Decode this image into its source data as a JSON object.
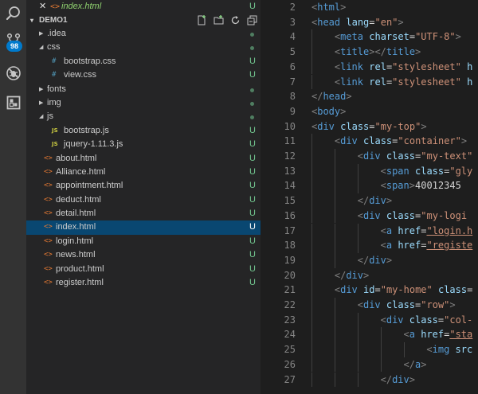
{
  "activity_bar": {
    "items": [
      {
        "name": "search-icon"
      },
      {
        "name": "source-control-icon",
        "badge": "98"
      },
      {
        "name": "debug-icon"
      },
      {
        "name": "extensions-icon"
      }
    ]
  },
  "open_editor": {
    "close": "✕",
    "icon": "<>",
    "file": "index.html",
    "status": "U"
  },
  "explorer": {
    "caret": "▾",
    "project": "DEMO1",
    "status": "U",
    "tools": [
      "new-file-icon",
      "new-folder-icon",
      "refresh-icon",
      "collapse-all-icon"
    ],
    "tree": [
      {
        "type": "folder",
        "label": ".idea",
        "open": false,
        "depth": 0,
        "status": "dot"
      },
      {
        "type": "folder",
        "label": "css",
        "open": true,
        "depth": 0,
        "status": "dot"
      },
      {
        "type": "css",
        "label": "bootstrap.css",
        "depth": 1,
        "status": "U"
      },
      {
        "type": "css",
        "label": "view.css",
        "depth": 1,
        "status": "U"
      },
      {
        "type": "folder",
        "label": "fonts",
        "open": false,
        "depth": 0,
        "status": "dot"
      },
      {
        "type": "folder",
        "label": "img",
        "open": false,
        "depth": 0,
        "status": "dot"
      },
      {
        "type": "folder",
        "label": "js",
        "open": true,
        "depth": 0,
        "status": "dot"
      },
      {
        "type": "js",
        "label": "bootstrap.js",
        "depth": 1,
        "status": "U"
      },
      {
        "type": "js",
        "label": "jquery-1.11.3.js",
        "depth": 1,
        "status": "U"
      },
      {
        "type": "html",
        "label": "about.html",
        "depth": 0,
        "status": "U"
      },
      {
        "type": "html",
        "label": "Alliance.html",
        "depth": 0,
        "status": "U"
      },
      {
        "type": "html",
        "label": "appointment.html",
        "depth": 0,
        "status": "U"
      },
      {
        "type": "html",
        "label": "deduct.html",
        "depth": 0,
        "status": "U"
      },
      {
        "type": "html",
        "label": "detail.html",
        "depth": 0,
        "status": "U"
      },
      {
        "type": "html",
        "label": "index.html",
        "depth": 0,
        "status": "U",
        "selected": true
      },
      {
        "type": "html",
        "label": "login.html",
        "depth": 0,
        "status": "U"
      },
      {
        "type": "html",
        "label": "news.html",
        "depth": 0,
        "status": "U"
      },
      {
        "type": "html",
        "label": "product.html",
        "depth": 0,
        "status": "U"
      },
      {
        "type": "html",
        "label": "register.html",
        "depth": 0,
        "status": "U"
      }
    ]
  },
  "editor": {
    "lines": [
      {
        "n": "2",
        "indent": 0,
        "tokens": [
          [
            "p",
            "<"
          ],
          [
            "t",
            "html"
          ],
          [
            "p",
            ">"
          ]
        ]
      },
      {
        "n": "3",
        "indent": 0,
        "tokens": [
          [
            "p",
            "<"
          ],
          [
            "t",
            "head"
          ],
          [
            "x",
            " "
          ],
          [
            "a",
            "lang"
          ],
          [
            "x",
            "="
          ],
          [
            "s",
            "\"en\""
          ],
          [
            "p",
            ">"
          ]
        ]
      },
      {
        "n": "4",
        "indent": 1,
        "tokens": [
          [
            "p",
            "<"
          ],
          [
            "t",
            "meta"
          ],
          [
            "x",
            " "
          ],
          [
            "a",
            "charset"
          ],
          [
            "x",
            "="
          ],
          [
            "s",
            "\"UTF-8\""
          ],
          [
            "p",
            ">"
          ]
        ]
      },
      {
        "n": "5",
        "indent": 1,
        "tokens": [
          [
            "p",
            "<"
          ],
          [
            "t",
            "title"
          ],
          [
            "p",
            "></"
          ],
          [
            "t",
            "title"
          ],
          [
            "p",
            ">"
          ]
        ]
      },
      {
        "n": "6",
        "indent": 1,
        "tokens": [
          [
            "p",
            "<"
          ],
          [
            "t",
            "link"
          ],
          [
            "x",
            " "
          ],
          [
            "a",
            "rel"
          ],
          [
            "x",
            "="
          ],
          [
            "s",
            "\"stylesheet\""
          ],
          [
            "x",
            " "
          ],
          [
            "a",
            "h"
          ]
        ]
      },
      {
        "n": "7",
        "indent": 1,
        "tokens": [
          [
            "p",
            "<"
          ],
          [
            "t",
            "link"
          ],
          [
            "x",
            " "
          ],
          [
            "a",
            "rel"
          ],
          [
            "x",
            "="
          ],
          [
            "s",
            "\"stylesheet\""
          ],
          [
            "x",
            " "
          ],
          [
            "a",
            "h"
          ]
        ]
      },
      {
        "n": "8",
        "indent": 0,
        "tokens": [
          [
            "p",
            "</"
          ],
          [
            "t",
            "head"
          ],
          [
            "p",
            ">"
          ]
        ]
      },
      {
        "n": "9",
        "indent": 0,
        "tokens": [
          [
            "p",
            "<"
          ],
          [
            "t",
            "body"
          ],
          [
            "p",
            ">"
          ]
        ]
      },
      {
        "n": "10",
        "indent": 0,
        "tokens": [
          [
            "p",
            "<"
          ],
          [
            "t",
            "div"
          ],
          [
            "x",
            " "
          ],
          [
            "a",
            "class"
          ],
          [
            "x",
            "="
          ],
          [
            "s",
            "\"my-top\""
          ],
          [
            "p",
            ">"
          ]
        ]
      },
      {
        "n": "11",
        "indent": 1,
        "tokens": [
          [
            "p",
            "<"
          ],
          [
            "t",
            "div"
          ],
          [
            "x",
            " "
          ],
          [
            "a",
            "class"
          ],
          [
            "x",
            "="
          ],
          [
            "s",
            "\"container\""
          ],
          [
            "p",
            ">"
          ]
        ]
      },
      {
        "n": "12",
        "indent": 2,
        "tokens": [
          [
            "p",
            "<"
          ],
          [
            "t",
            "div"
          ],
          [
            "x",
            " "
          ],
          [
            "a",
            "class"
          ],
          [
            "x",
            "="
          ],
          [
            "s",
            "\"my-text\""
          ]
        ]
      },
      {
        "n": "13",
        "indent": 3,
        "tokens": [
          [
            "p",
            "<"
          ],
          [
            "t",
            "span"
          ],
          [
            "x",
            " "
          ],
          [
            "a",
            "class"
          ],
          [
            "x",
            "="
          ],
          [
            "s",
            "\"gly"
          ]
        ]
      },
      {
        "n": "14",
        "indent": 3,
        "tokens": [
          [
            "p",
            "<"
          ],
          [
            "t",
            "span"
          ],
          [
            "p",
            ">"
          ],
          [
            "x",
            "40012345"
          ]
        ]
      },
      {
        "n": "15",
        "indent": 2,
        "tokens": [
          [
            "p",
            "</"
          ],
          [
            "t",
            "div"
          ],
          [
            "p",
            ">"
          ]
        ]
      },
      {
        "n": "16",
        "indent": 2,
        "tokens": [
          [
            "p",
            "<"
          ],
          [
            "t",
            "div"
          ],
          [
            "x",
            " "
          ],
          [
            "a",
            "class"
          ],
          [
            "x",
            "="
          ],
          [
            "s",
            "\"my-logi"
          ]
        ]
      },
      {
        "n": "17",
        "indent": 3,
        "tokens": [
          [
            "p",
            "<"
          ],
          [
            "t",
            "a"
          ],
          [
            "x",
            " "
          ],
          [
            "a",
            "href"
          ],
          [
            "x",
            "="
          ],
          [
            "su",
            "\"login.h"
          ]
        ]
      },
      {
        "n": "18",
        "indent": 3,
        "tokens": [
          [
            "p",
            "<"
          ],
          [
            "t",
            "a"
          ],
          [
            "x",
            " "
          ],
          [
            "a",
            "href"
          ],
          [
            "x",
            "="
          ],
          [
            "su",
            "\"registe"
          ]
        ]
      },
      {
        "n": "19",
        "indent": 2,
        "tokens": [
          [
            "p",
            "</"
          ],
          [
            "t",
            "div"
          ],
          [
            "p",
            ">"
          ]
        ]
      },
      {
        "n": "20",
        "indent": 1,
        "tokens": [
          [
            "p",
            "</"
          ],
          [
            "t",
            "div"
          ],
          [
            "p",
            ">"
          ]
        ]
      },
      {
        "n": "21",
        "indent": 1,
        "tokens": [
          [
            "p",
            "<"
          ],
          [
            "t",
            "div"
          ],
          [
            "x",
            " "
          ],
          [
            "a",
            "id"
          ],
          [
            "x",
            "="
          ],
          [
            "s",
            "\"my-home\""
          ],
          [
            "x",
            " "
          ],
          [
            "a",
            "class"
          ],
          [
            "x",
            "="
          ]
        ]
      },
      {
        "n": "22",
        "indent": 2,
        "tokens": [
          [
            "p",
            "<"
          ],
          [
            "t",
            "div"
          ],
          [
            "x",
            " "
          ],
          [
            "a",
            "class"
          ],
          [
            "x",
            "="
          ],
          [
            "s",
            "\"row\""
          ],
          [
            "p",
            ">"
          ]
        ]
      },
      {
        "n": "23",
        "indent": 3,
        "tokens": [
          [
            "p",
            "<"
          ],
          [
            "t",
            "div"
          ],
          [
            "x",
            " "
          ],
          [
            "a",
            "class"
          ],
          [
            "x",
            "="
          ],
          [
            "s",
            "\"col-"
          ]
        ]
      },
      {
        "n": "24",
        "indent": 4,
        "tokens": [
          [
            "p",
            "<"
          ],
          [
            "t",
            "a"
          ],
          [
            "x",
            " "
          ],
          [
            "a",
            "href"
          ],
          [
            "x",
            "="
          ],
          [
            "su",
            "\"sta"
          ]
        ]
      },
      {
        "n": "25",
        "indent": 5,
        "tokens": [
          [
            "p",
            "<"
          ],
          [
            "t",
            "img"
          ],
          [
            "x",
            " "
          ],
          [
            "a",
            "src"
          ]
        ]
      },
      {
        "n": "26",
        "indent": 4,
        "tokens": [
          [
            "p",
            "</"
          ],
          [
            "t",
            "a"
          ],
          [
            "p",
            ">"
          ]
        ]
      },
      {
        "n": "27",
        "indent": 3,
        "tokens": [
          [
            "p",
            "</"
          ],
          [
            "t",
            "div"
          ],
          [
            "p",
            ">"
          ]
        ]
      }
    ]
  },
  "colors": {
    "accent": "#007acc",
    "selection": "#094771",
    "untracked": "#73c991",
    "html_icon": "#e37933",
    "css_icon": "#519aba",
    "js_icon": "#cbcb41"
  }
}
